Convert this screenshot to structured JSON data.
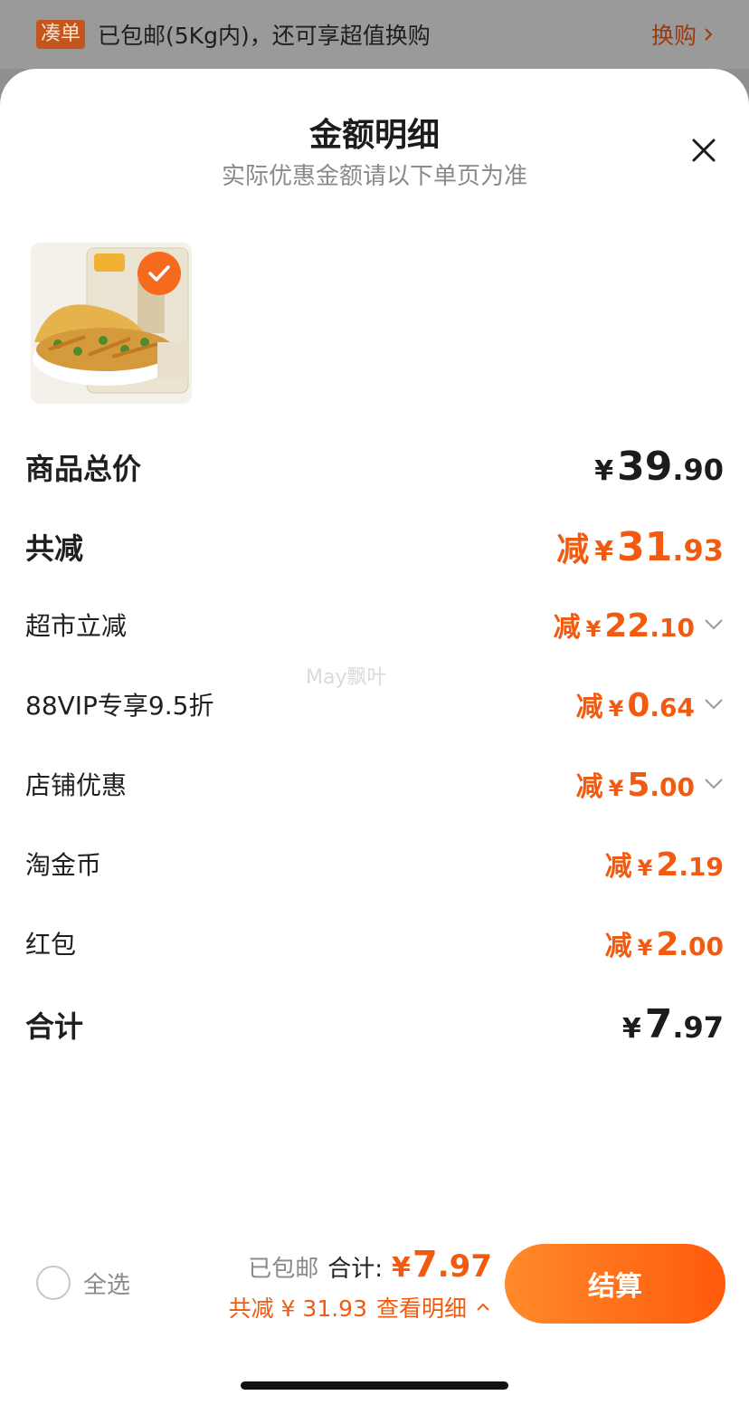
{
  "banner": {
    "tag": "凑单",
    "text": "已包邮(5Kg内)，还可享超值换购",
    "link_label": "换购",
    "chevron_icon": "chevron-right-icon"
  },
  "sheet": {
    "title": "金额明细",
    "subtitle": "实际优惠金额请以下单页为准",
    "close_icon": "close-icon"
  },
  "product": {
    "image_icon": "snack-product-image",
    "selected": true
  },
  "rows": [
    {
      "label": "商品总价",
      "prefix": "",
      "yen": "¥",
      "int": "39",
      "dec": ".90",
      "style": "major",
      "color": "black",
      "expandable": false
    },
    {
      "label": "共减",
      "prefix": "减",
      "yen": "¥",
      "int": "31",
      "dec": ".93",
      "style": "major",
      "color": "orange",
      "expandable": false
    },
    {
      "label": "超市立减",
      "prefix": "减",
      "yen": "¥",
      "int": "22",
      "dec": ".10",
      "style": "minor",
      "color": "orange",
      "expandable": true
    },
    {
      "label": "88VIP专享9.5折",
      "prefix": "减",
      "yen": "¥",
      "int": "0",
      "dec": ".64",
      "style": "minor",
      "color": "orange",
      "expandable": true
    },
    {
      "label": "店铺优惠",
      "prefix": "减",
      "yen": "¥",
      "int": "5",
      "dec": ".00",
      "style": "minor",
      "color": "orange",
      "expandable": true
    },
    {
      "label": "淘金币",
      "prefix": "减",
      "yen": "¥",
      "int": "2",
      "dec": ".19",
      "style": "minor",
      "color": "orange",
      "expandable": false
    },
    {
      "label": "红包",
      "prefix": "减",
      "yen": "¥",
      "int": "2",
      "dec": ".00",
      "style": "minor",
      "color": "orange",
      "expandable": false
    },
    {
      "label": "合计",
      "prefix": "",
      "yen": "¥",
      "int": "7",
      "dec": ".97",
      "style": "major",
      "color": "black",
      "expandable": false
    }
  ],
  "watermark": "May飘叶",
  "bottom": {
    "select_all_label": "全选",
    "free_shipping": "已包邮",
    "total_label": "合计:",
    "total_yen": "¥",
    "total_int": "7",
    "total_dec": ".97",
    "discount_text": "共减 ¥ 31.93",
    "view_detail": "查看明细",
    "checkout_label": "结算"
  },
  "colors": {
    "accent": "#f25a0f",
    "button_start": "#ff8a2a",
    "button_end": "#ff5a0c"
  }
}
